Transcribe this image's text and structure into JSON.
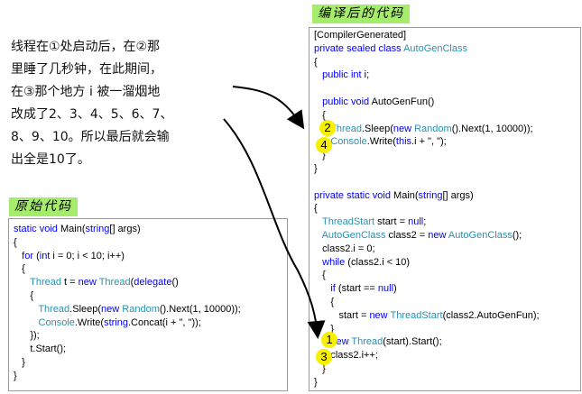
{
  "labels": {
    "compiled_tag": "编译后的代码",
    "original_tag": "原始代码"
  },
  "note": {
    "lines": [
      "线程在①处启动后，在②那",
      "里睡了几秒钟，在此期间，",
      "在③那个地方 i 被一溜烟地",
      "改成了2、3、4、5、6、7、",
      "8、9、10。所以最后就会输",
      "出全是10了。"
    ]
  },
  "compiled_code": [
    [
      [
        "t",
        "[CompilerGenerated]"
      ]
    ],
    [
      [
        "k",
        "private sealed class "
      ],
      [
        "y",
        "AutoGenClass"
      ]
    ],
    [
      [
        "t",
        "{"
      ]
    ],
    [
      [
        "t",
        "   "
      ],
      [
        "k",
        "public int"
      ],
      [
        "t",
        " i;"
      ]
    ],
    [
      [
        "t",
        ""
      ]
    ],
    [
      [
        "t",
        "   "
      ],
      [
        "k",
        "public void"
      ],
      [
        "t",
        " AutoGenFun()"
      ]
    ],
    [
      [
        "t",
        "   {"
      ]
    ],
    [
      [
        "t",
        "      "
      ],
      [
        "y",
        "Thread"
      ],
      [
        "t",
        ".Sleep("
      ],
      [
        "k",
        "new "
      ],
      [
        "y",
        "Random"
      ],
      [
        "t",
        "().Next(1, 10000));"
      ]
    ],
    [
      [
        "t",
        "      "
      ],
      [
        "y",
        "Console"
      ],
      [
        "t",
        ".Write("
      ],
      [
        "k",
        "this"
      ],
      [
        "t",
        ".i + \", \");"
      ]
    ],
    [
      [
        "t",
        "   }"
      ]
    ],
    [
      [
        "t",
        "}"
      ]
    ],
    [
      [
        "t",
        ""
      ]
    ],
    [
      [
        "k",
        "private static void"
      ],
      [
        "t",
        " Main("
      ],
      [
        "k",
        "string"
      ],
      [
        "t",
        "[] args)"
      ]
    ],
    [
      [
        "t",
        "{"
      ]
    ],
    [
      [
        "t",
        "   "
      ],
      [
        "y",
        "ThreadStart"
      ],
      [
        "t",
        " start = "
      ],
      [
        "k",
        "null"
      ],
      [
        "t",
        ";"
      ]
    ],
    [
      [
        "t",
        "   "
      ],
      [
        "y",
        "AutoGenClass"
      ],
      [
        "t",
        " class2 = "
      ],
      [
        "k",
        "new "
      ],
      [
        "y",
        "AutoGenClass"
      ],
      [
        "t",
        "();"
      ]
    ],
    [
      [
        "t",
        "   class2.i = 0;"
      ]
    ],
    [
      [
        "t",
        "   "
      ],
      [
        "k",
        "while"
      ],
      [
        "t",
        " (class2.i < 10)"
      ]
    ],
    [
      [
        "t",
        "   {"
      ]
    ],
    [
      [
        "t",
        "      "
      ],
      [
        "k",
        "if"
      ],
      [
        "t",
        " (start == "
      ],
      [
        "k",
        "null"
      ],
      [
        "t",
        ")"
      ]
    ],
    [
      [
        "t",
        "      {"
      ]
    ],
    [
      [
        "t",
        "         start = "
      ],
      [
        "k",
        "new "
      ],
      [
        "y",
        "ThreadStart"
      ],
      [
        "t",
        "(class2.AutoGenFun);"
      ]
    ],
    [
      [
        "t",
        "      }"
      ]
    ],
    [
      [
        "t",
        "      "
      ],
      [
        "k",
        "new "
      ],
      [
        "y",
        "Thread"
      ],
      [
        "t",
        "(start).Start();"
      ]
    ],
    [
      [
        "t",
        "      class2.i++;"
      ]
    ],
    [
      [
        "t",
        "   }"
      ]
    ],
    [
      [
        "t",
        "}"
      ]
    ]
  ],
  "original_code": [
    [
      [
        "k",
        "static void"
      ],
      [
        "t",
        " Main("
      ],
      [
        "k",
        "string"
      ],
      [
        "t",
        "[] args)"
      ]
    ],
    [
      [
        "t",
        "{"
      ]
    ],
    [
      [
        "t",
        "   "
      ],
      [
        "k",
        "for"
      ],
      [
        "t",
        " ("
      ],
      [
        "k",
        "int"
      ],
      [
        "t",
        " i = 0; i < 10; i++)"
      ]
    ],
    [
      [
        "t",
        "   {"
      ]
    ],
    [
      [
        "t",
        "      "
      ],
      [
        "y",
        "Thread"
      ],
      [
        "t",
        " t = "
      ],
      [
        "k",
        "new "
      ],
      [
        "y",
        "Thread"
      ],
      [
        "t",
        "("
      ],
      [
        "k",
        "delegate"
      ],
      [
        "t",
        "()"
      ]
    ],
    [
      [
        "t",
        "      {"
      ]
    ],
    [
      [
        "t",
        "         "
      ],
      [
        "y",
        "Thread"
      ],
      [
        "t",
        ".Sleep("
      ],
      [
        "k",
        "new "
      ],
      [
        "y",
        "Random"
      ],
      [
        "t",
        "().Next(1, 10000));"
      ]
    ],
    [
      [
        "t",
        "         "
      ],
      [
        "y",
        "Console"
      ],
      [
        "t",
        ".Write("
      ],
      [
        "k",
        "string"
      ],
      [
        "t",
        ".Concat(i + \", \"));"
      ]
    ],
    [
      [
        "t",
        "      });"
      ]
    ],
    [
      [
        "t",
        "      t.Start();"
      ]
    ],
    [
      [
        "t",
        "   }"
      ]
    ],
    [
      [
        "t",
        "}"
      ]
    ]
  ],
  "markers": [
    "2",
    "4",
    "1",
    "3"
  ],
  "colors": {
    "keyword": "#0000ff",
    "type": "#2b91af",
    "tag_bg": "#a6ec6c",
    "marker": "#f7f000"
  }
}
